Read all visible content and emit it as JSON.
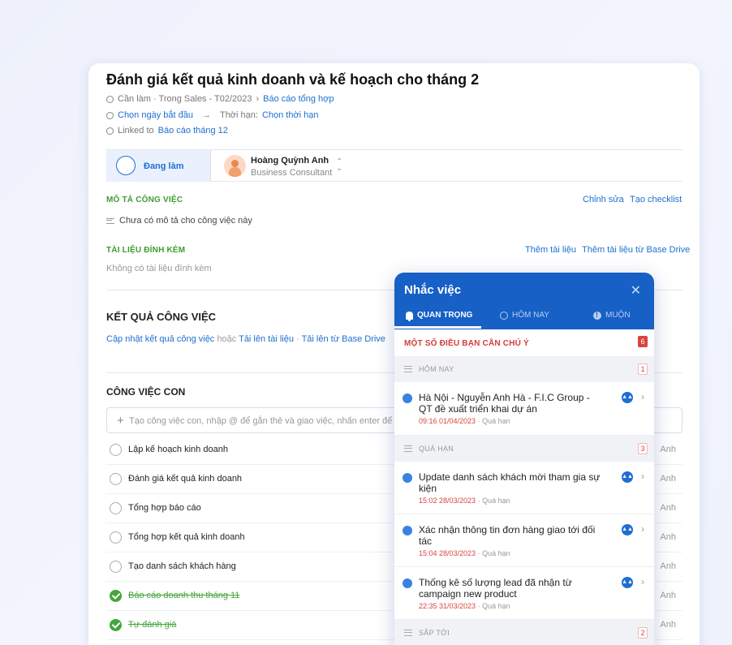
{
  "task": {
    "title": "Đánh giá kết quả kinh doanh và kế hoạch cho tháng 2",
    "breadcrumb": "Cần làm · Trong Sales - T02/2023",
    "breadcrumb_link": "Báo cáo tổng hợp",
    "start_date": "Chọn ngày bắt đầu",
    "deadline_label": "Thời hạn:",
    "deadline_value": "Chọn thời hạn",
    "linked_label": "Linked to",
    "linked_value": "Báo cáo tháng 12",
    "status": "Đang làm",
    "assignee_name": "Hoàng Quỳnh Anh",
    "assignee_role": "Business Consultant"
  },
  "description": {
    "heading": "MÔ TẢ CÔNG VIỆC",
    "edit": "Chỉnh sửa",
    "checklist": "Tạo checklist",
    "empty": "Chưa có mô tả cho công việc này"
  },
  "attachments": {
    "heading": "TÀI LIỆU ĐÍNH KÈM",
    "add": "Thêm tài liệu",
    "add_drive": "Thêm tài liệu từ Base Drive",
    "empty": "Không có tài liệu đính kèm"
  },
  "result": {
    "heading": "KẾT QUẢ CÔNG VIỆC",
    "update": "Cập nhật kết quả công việc",
    "or": "hoặc",
    "upload": "Tải lên tài liệu",
    "sep": "·",
    "upload_drive": "Tải lên từ Base Drive"
  },
  "subtasks": {
    "heading": "CÔNG VIỆC CON",
    "placeholder": "Tạo công việc con, nhập @ để gắn thẻ và giao việc, nhấn enter để lưu",
    "items": [
      {
        "label": "Lập kế hoạch kinh doanh",
        "owner": "Anh",
        "done": false
      },
      {
        "label": "Đánh giá kết quả kinh doanh",
        "owner": "Anh",
        "done": false
      },
      {
        "label": "Tổng hợp báo cáo",
        "owner": "Anh",
        "done": false
      },
      {
        "label": "Tổng hợp kết quả kinh doanh",
        "owner": "Anh",
        "done": false
      },
      {
        "label": "Tạo danh sách khách hàng",
        "owner": "Anh",
        "done": false
      },
      {
        "label": "Báo cáo doanh thu tháng 11",
        "owner": "Anh",
        "done": true
      },
      {
        "label": "Tự đánh giá",
        "owner": "Anh",
        "done": true
      }
    ]
  },
  "reminder": {
    "title": "Nhắc việc",
    "tabs": [
      "QUAN TRỌNG",
      "HÔM NAY",
      "MUỘN"
    ],
    "alert": "MỘT SỐ ĐIỀU BẠN CẦN CHÚ Ý",
    "alert_count": "6",
    "groups": [
      {
        "name": "HÔM NAY",
        "count": "1"
      },
      {
        "name": "QUÁ HẠN",
        "count": "3"
      },
      {
        "name": "SẮP TỚI",
        "count": "2"
      }
    ],
    "items": [
      {
        "title": "Hà Nội - Nguyễn Anh Hà - F.I.C Group - QT đề xuất triển khai dự án",
        "time": "09:16 01/04/2023",
        "status": "· Quá hạn"
      },
      {
        "title": "Update danh sách khách mời tham gia sự kiện",
        "time": "15:02 28/03/2023",
        "status": "· Quá hạn"
      },
      {
        "title": "Xác nhận thông tin đơn hàng giao tới đối tác",
        "time": "15:04 28/03/2023",
        "status": "· Quá hạn"
      },
      {
        "title": "Thống kê số lượng lead đã nhận từ campaign new product",
        "time": "22:35 31/03/2023",
        "status": "· Quá hạn"
      }
    ]
  }
}
